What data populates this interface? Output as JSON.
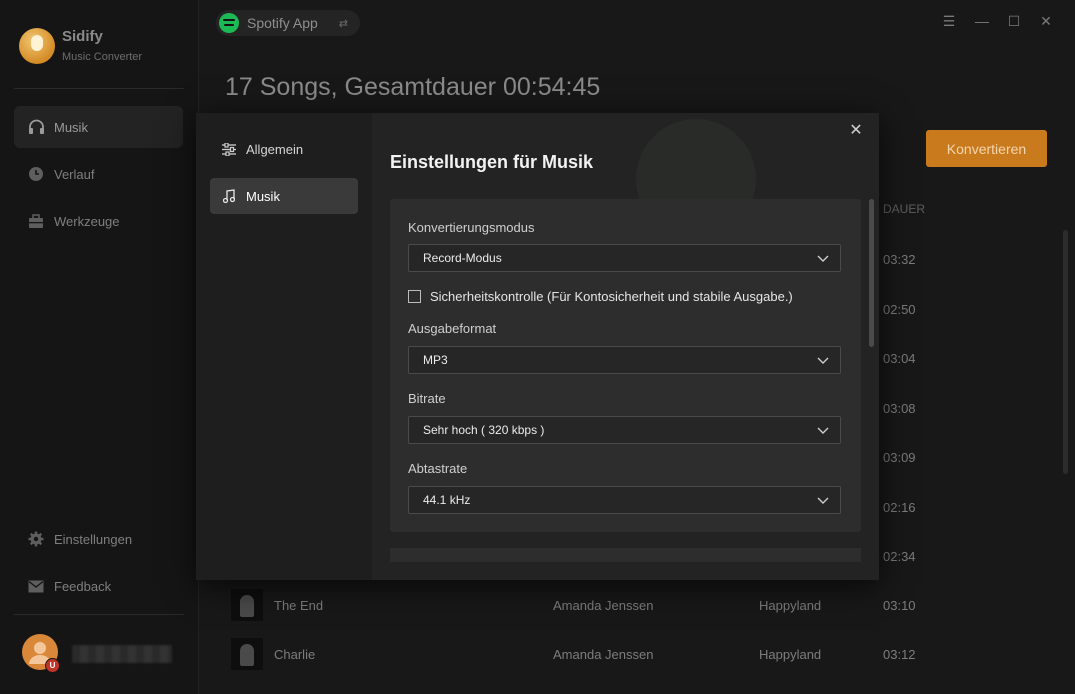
{
  "sidebar": {
    "app_name": "Sidify",
    "app_subtitle": "Music Converter",
    "nav": [
      {
        "label": "Musik",
        "icon": "headphones-icon"
      },
      {
        "label": "Verlauf",
        "icon": "clock-icon"
      },
      {
        "label": "Werkzeuge",
        "icon": "toolbox-icon"
      }
    ],
    "bottom": [
      {
        "label": "Einstellungen",
        "icon": "gear-icon"
      },
      {
        "label": "Feedback",
        "icon": "mail-icon"
      }
    ],
    "avatar_badge": "U"
  },
  "topbar": {
    "source_label": "Spotify App",
    "swap_icon": "swap-icon"
  },
  "main": {
    "summary": "17 Songs, Gesamtdauer 00:54:45",
    "convert_label": "Konvertieren",
    "dauer_header": "DAUER",
    "durations_behind_dialog": [
      "03:32",
      "02:50",
      "03:04",
      "03:08",
      "03:09",
      "02:16",
      "02:34"
    ],
    "rows": [
      {
        "title": "The End",
        "artist": "Amanda Jenssen",
        "album": "Happyland",
        "duration": "03:10"
      },
      {
        "title": "Charlie",
        "artist": "Amanda Jenssen",
        "album": "Happyland",
        "duration": "03:12"
      }
    ]
  },
  "dialog": {
    "nav": [
      {
        "label": "Allgemein",
        "icon": "sliders-icon"
      },
      {
        "label": "Musik",
        "icon": "music-note-icon"
      }
    ],
    "title": "Einstellungen für Musik",
    "close_icon": "close-icon",
    "fields": {
      "mode_label": "Konvertierungsmodus",
      "mode_value": "Record-Modus",
      "security_check_label": "Sicherheitskontrolle (Für Kontosicherheit und stabile Ausgabe.)",
      "security_checked": false,
      "format_label": "Ausgabeformat",
      "format_value": "MP3",
      "bitrate_label": "Bitrate",
      "bitrate_value": "Sehr hoch ( 320 kbps )",
      "samplerate_label": "Abtastrate",
      "samplerate_value": "44.1 kHz"
    }
  },
  "colors": {
    "accent": "#c97a1d",
    "spotify_green": "#1db954"
  }
}
